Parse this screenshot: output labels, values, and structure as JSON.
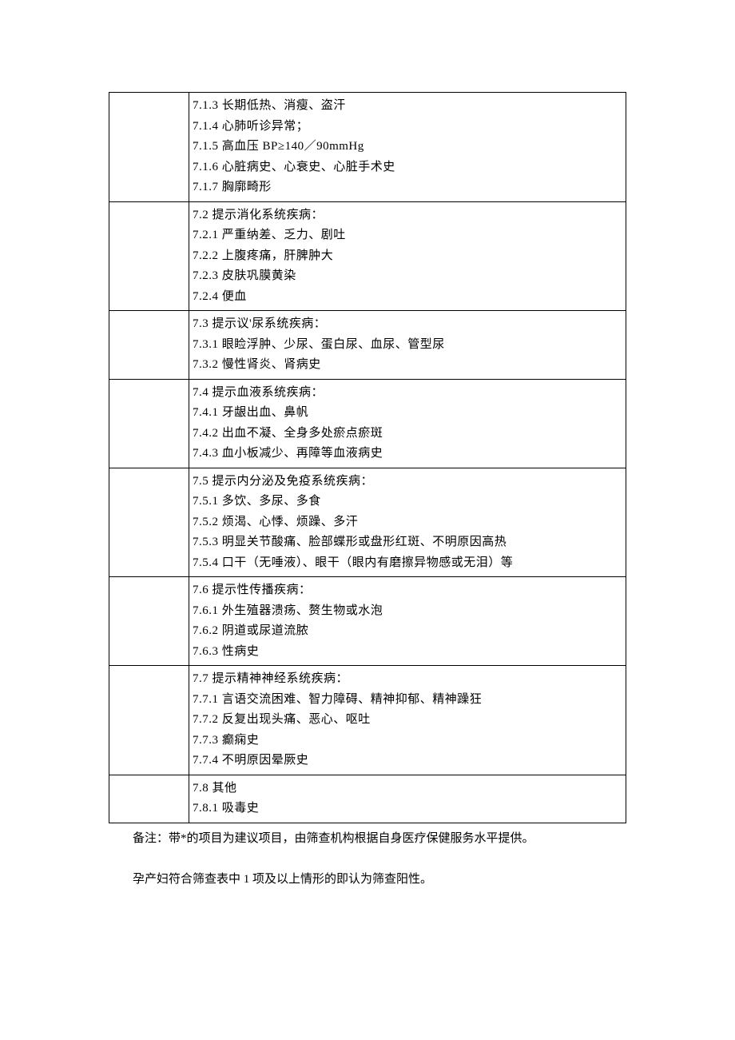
{
  "sections": [
    {
      "lines": [
        "7.1.3 长期低热、消瘦、盗汗",
        "7.1.4 心肺听诊异常；",
        "7.1.5 高血压 BP≥140／90mmHg",
        "7.1.6 心脏病史、心衰史、心脏手术史",
        "7.1.7 胸廓畸形"
      ]
    },
    {
      "lines": [
        "7.2 提示消化系统疾病：",
        "7.2.1 严重纳差、乏力、剧吐",
        "7.2.2 上腹疼痛，肝脾肿大",
        "7.2.3 皮肤巩膜黄染",
        "7.2.4 便血"
      ]
    },
    {
      "lines": [
        "7.3 提示议'尿系统疾病：",
        "7.3.1 眼睑浮肿、少尿、蛋白尿、血尿、管型尿",
        "7.3.2 慢性肾炎、肾病史"
      ]
    },
    {
      "lines": [
        "7.4 提示血液系统疾病：",
        "7.4.1 牙龈出血、鼻帆",
        "7.4.2 出血不凝、全身多处瘀点瘀斑",
        "7.4.3 血小板减少、再障等血液病史"
      ]
    },
    {
      "lines": [
        "7.5 提示内分泌及免疫系统疾病：",
        "7.5.1 多饮、多尿、多食",
        "7.5.2 烦渴、心悸、烦躁、多汗",
        "7.5.3 明显关节酸痛、脸部蝶形或盘形红斑、不明原因高热",
        "7.5.4 口干（无唾液）、眼干（眼内有磨擦异物感或无泪）等"
      ]
    },
    {
      "lines": [
        "7.6 提示性传播疾病：",
        "7.6.1 外生殖器溃疡、赘生物或水泡",
        "7.6.2 阴道或尿道流脓",
        "7.6.3 性病史"
      ]
    },
    {
      "lines": [
        "7.7 提示精神神经系统疾病：",
        "7.7.1 言语交流困难、智力障碍、精神抑郁、精神躁狂",
        "7.7.2 反复出现头痛、恶心、呕吐",
        "7.7.3 癫痫史",
        "7.7.4 不明原因晕厥史"
      ]
    },
    {
      "lines": [
        "7.8 其他",
        "7.8.1 吸毒史"
      ]
    }
  ],
  "notes": {
    "line1": "备注：带*的项目为建议项目，由筛查机构根据自身医疗保健服务水平提供。",
    "line2": "孕产妇符合筛查表中 1 项及以上情形的即认为筛查阳性。"
  }
}
